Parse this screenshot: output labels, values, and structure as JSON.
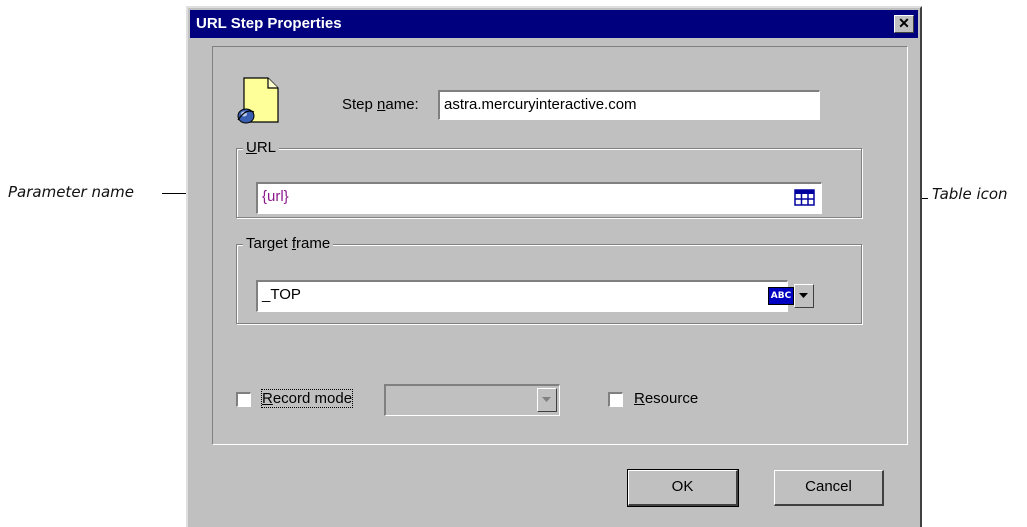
{
  "callouts": {
    "parameter_name": "Parameter name",
    "table_icon": "Table icon"
  },
  "dialog": {
    "title": "URL Step Properties",
    "close_glyph": "✕",
    "step_name": {
      "label_before": "Step ",
      "label_mnemonic": "n",
      "label_after": "ame:",
      "value": "astra.mercuryinteractive.com"
    },
    "url_group": {
      "title_mnemonic": "U",
      "title_rest": "RL",
      "value": "{url}",
      "value_color": "#8b1a8b"
    },
    "target_frame": {
      "title_before": "Target ",
      "title_mnemonic": "f",
      "title_after": "rame",
      "value": "_TOP",
      "abc_label": "ABC"
    },
    "record_mode": {
      "mnemonic": "R",
      "rest": "ecord mode",
      "checked": false
    },
    "resource": {
      "mnemonic": "R",
      "rest": "esource",
      "checked": false
    },
    "buttons": {
      "ok": "OK",
      "cancel": "Cancel"
    }
  },
  "colors": {
    "title_bar": "#00007f",
    "dialog_face": "#c0c0c0"
  }
}
